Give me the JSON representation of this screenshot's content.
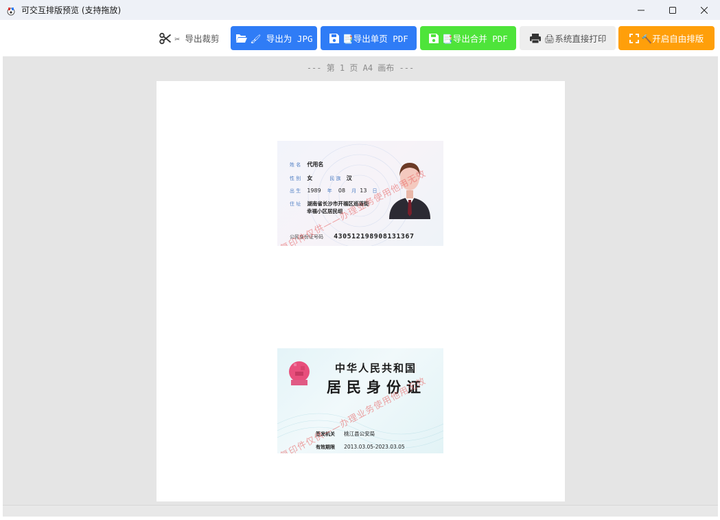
{
  "window": {
    "title": "可交互排版预览 (支持拖放)"
  },
  "toolbar": {
    "crop_label": "✂ 导出裁剪",
    "jpg_label": "🖌 导出为 JPG",
    "single_pdf_label": "📑导出单页 PDF",
    "merge_pdf_label": "📑导出合并 PDF",
    "print_label": "🖨系统直接打印",
    "free_layout_label": "🔨开启自由排版"
  },
  "canvas": {
    "page_label": "--- 第 1 页 A4 画布 ---"
  },
  "id_front": {
    "name_label": "姓 名",
    "name_value": "代用名",
    "gender_label": "性 别",
    "gender_value": "女",
    "ethnicity_label": "民 族",
    "ethnicity_value": "汉",
    "birth_label": "出 生",
    "birth_year": "1989",
    "year_label": "年",
    "birth_month": "08",
    "month_label": "月",
    "birth_day": "13",
    "day_label": "日",
    "address_label": "住 址",
    "address_line1": "湖南省长沙市开福区巡道街",
    "address_line2": "幸福小区居民组",
    "id_label": "公民身份证号码",
    "id_number": "430512198908131367",
    "watermark": "本复印件仅供——办理业务使用他用无效"
  },
  "id_back": {
    "nation": "中华人民共和国",
    "title": "居民身份证",
    "authority_label": "签发机关",
    "authority_value": "桃江县公安局",
    "validity_label": "有效期限",
    "validity_value": "2013.03.05-2023.03.05",
    "watermark": "本复印件仅供——办理业务使用他用无效"
  },
  "colors": {
    "primary_button": "#2f7cf6",
    "merge_button": "#4ee43a",
    "free_layout_button": "#ff9f0a",
    "canvas_bg": "#e5e5e5",
    "watermark": "#e85a5a"
  },
  "icons": {
    "app": "app-logo-icon",
    "crop": "scissors-icon",
    "jpg": "folder-open-icon",
    "single_pdf": "save-icon",
    "merge_pdf": "save-icon",
    "print": "printer-icon",
    "free_layout": "expand-icon"
  }
}
